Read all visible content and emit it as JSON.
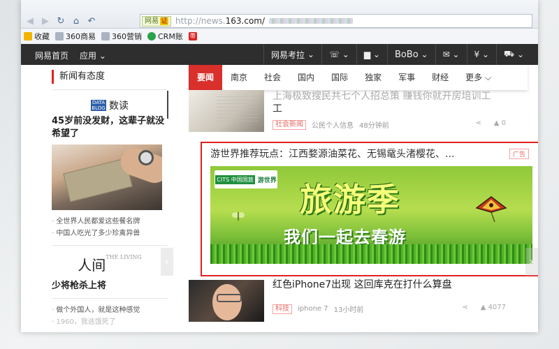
{
  "browser": {
    "url_prefix": "http://news.",
    "url_domain": "163.com/",
    "badge_label": "网易",
    "badge_cert": "证"
  },
  "bookmarks": [
    {
      "label": "收藏",
      "color": "#f2b400"
    },
    {
      "label": "360商易",
      "color": "#7a8a9a"
    },
    {
      "label": "360营销",
      "color": "#7a8a9a"
    },
    {
      "label": "CRM账",
      "color": "#2aa34a"
    },
    {
      "label": "帯",
      "color": "#d22"
    }
  ],
  "topnav": {
    "home": "网易首页",
    "apps": "应用",
    "kaola": "网易考拉",
    "user": "BoBo",
    "currency": "¥"
  },
  "left": {
    "section_title": "新闻有态度",
    "dudu_logo": "DATA BLOG",
    "dudu_title": "数读",
    "headline1": "45岁前没发财，这辈子就没希望了",
    "subs1": [
      "全世界人民都爱这些餐名牌",
      "中国人吃光了多少珍禽异兽"
    ],
    "renjian": "人间",
    "renjian_small": "THE LIVING",
    "headline2": "少将枪杀上将",
    "subs2": [
      "做个外国人，就是这种感觉",
      "1960，我逃饿死了"
    ]
  },
  "tabs": [
    "要闻",
    "南京",
    "社会",
    "国内",
    "国际",
    "独家",
    "军事",
    "财经",
    "更多"
  ],
  "feed": {
    "item1": {
      "title": "上海极致搜民共七个人招总策 赚钱你就开房培训工",
      "title2": "工",
      "tag": "社会新闻",
      "source": "公民个人信息",
      "time": "48分钟前",
      "comments": "0"
    },
    "ad": {
      "title": "游世界推荐玩点：江西婺源油菜花、无锡鼋头渚樱花、...",
      "tag": "广告",
      "logo_text": "CITS 中国国旅",
      "logo_brand": "游世界",
      "big_text": "旅游季",
      "slogan": "我们一起去春游"
    },
    "item3": {
      "title": "红色iPhone7出现 这回库克在打什么算盘",
      "tag": "科技",
      "source": "iphone 7",
      "time": "13小时前",
      "comments": "4077"
    }
  }
}
